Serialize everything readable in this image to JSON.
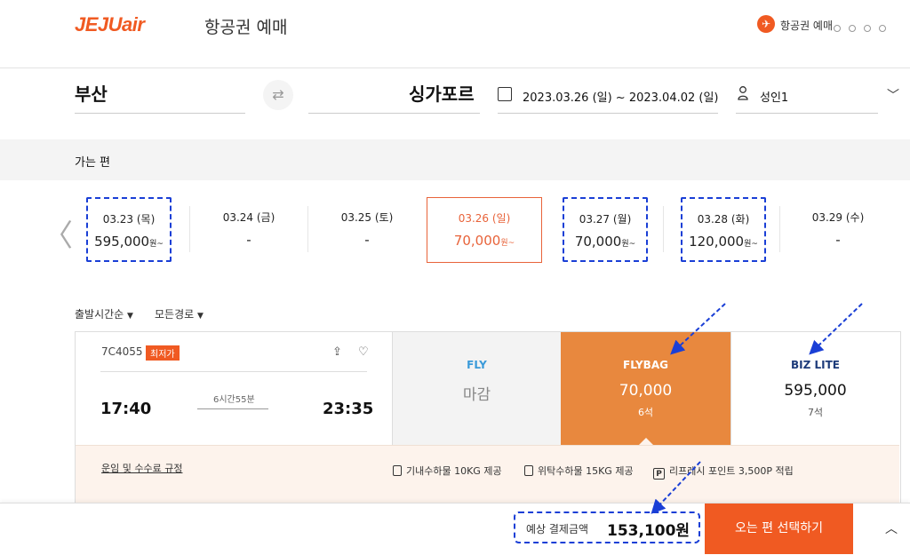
{
  "header": {
    "logo": "JEJUair",
    "title": "항공권 예매",
    "step_label": "항공권 예매"
  },
  "search": {
    "origin": "부산",
    "destination": "싱가포르",
    "dates": "2023.03.26 (일) ~ 2023.04.02 (일)",
    "passengers": "성인1"
  },
  "outbound": {
    "label": "가는 편",
    "dates": [
      {
        "date": "03.23 (목)",
        "price": "595,000",
        "unit": "원~"
      },
      {
        "date": "03.24 (금)",
        "price": "-",
        "unit": ""
      },
      {
        "date": "03.25 (토)",
        "price": "-",
        "unit": ""
      },
      {
        "date": "03.26 (일)",
        "price": "70,000",
        "unit": "원~"
      },
      {
        "date": "03.27 (월)",
        "price": "70,000",
        "unit": "원~"
      },
      {
        "date": "03.28 (화)",
        "price": "120,000",
        "unit": "원~"
      },
      {
        "date": "03.29 (수)",
        "price": "-",
        "unit": ""
      }
    ],
    "selected_index": 3
  },
  "sort": {
    "order": "출발시간순",
    "route": "모든경로"
  },
  "flight": {
    "number": "7C4055",
    "badge": "최저가",
    "depart": "17:40",
    "arrive": "23:35",
    "duration": "6시간55분",
    "fares": [
      {
        "name": "FLY",
        "price": "마감",
        "seats": ""
      },
      {
        "name": "FLYBAG",
        "price": "70,000",
        "seats": "6석"
      },
      {
        "name": "BIZ LITE",
        "price": "595,000",
        "seats": "7석"
      }
    ],
    "rules_link": "운임 및 수수료 규정",
    "cabin_bag": "기내수하물 10KG 제공",
    "checked_bag": "위탁수하물 15KG 제공",
    "points_glyph": "P",
    "points": "리프레시 포인트 3,500P 적립"
  },
  "bottom": {
    "estimate_label": "예상 결제금액",
    "estimate_value": "153,100원",
    "cta": "오는 편 선택하기"
  },
  "colors": {
    "brand": "#f05a22",
    "fare_selected": "#e8883e",
    "annotation": "#1a3fd6"
  }
}
